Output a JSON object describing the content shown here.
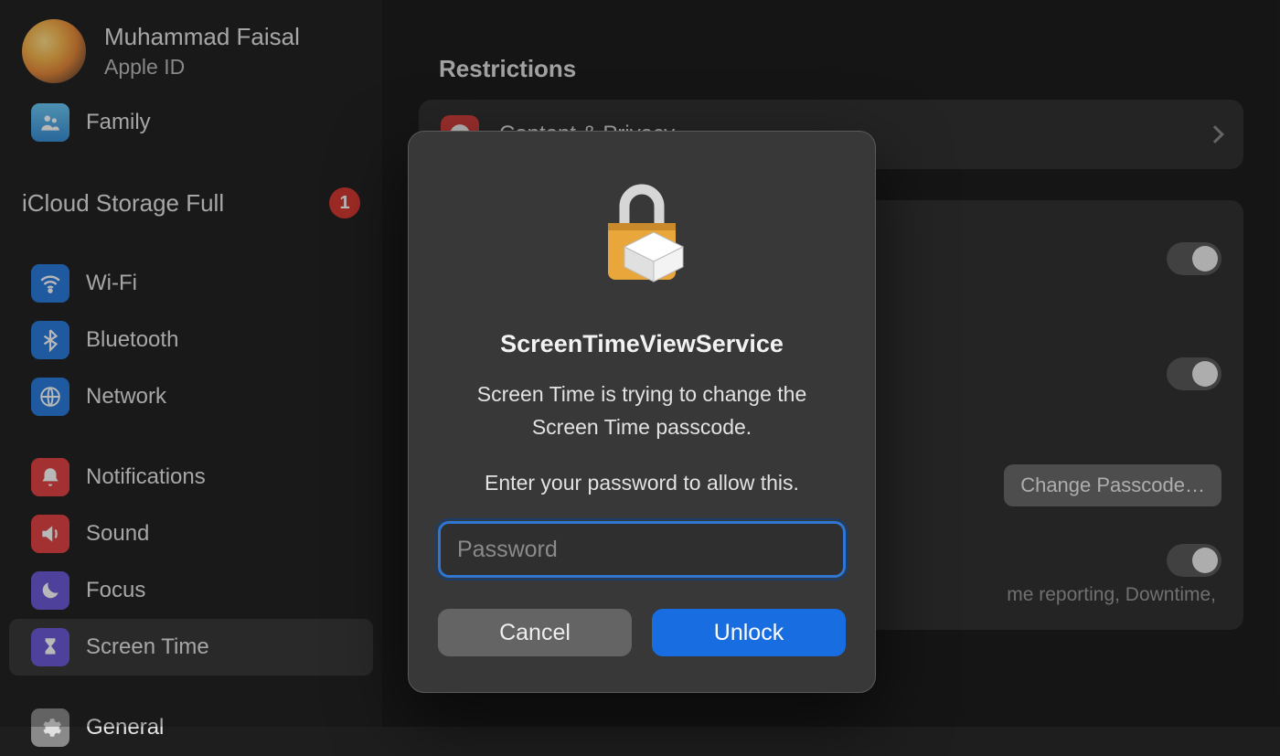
{
  "account": {
    "name": "Muhammad Faisal",
    "sub": "Apple ID"
  },
  "sidebar": {
    "family": "Family",
    "storage": {
      "label": "iCloud Storage Full",
      "badge": "1"
    },
    "items": {
      "wifi": "Wi-Fi",
      "bluetooth": "Bluetooth",
      "network": "Network",
      "notifications": "Notifications",
      "sound": "Sound",
      "focus": "Focus",
      "screentime": "Screen Time",
      "general": "General"
    }
  },
  "main": {
    "restrictions": "Restrictions",
    "content_privacy": "Content & Privacy",
    "change_passcode": "Change Passcode…",
    "reporting_fragment": "me reporting, Downtime,"
  },
  "modal": {
    "title": "ScreenTimeViewService",
    "message_line1": "Screen Time is trying to change the",
    "message_line2": "Screen Time passcode.",
    "hint": "Enter your password to allow this.",
    "placeholder": "Password",
    "cancel": "Cancel",
    "unlock": "Unlock"
  }
}
